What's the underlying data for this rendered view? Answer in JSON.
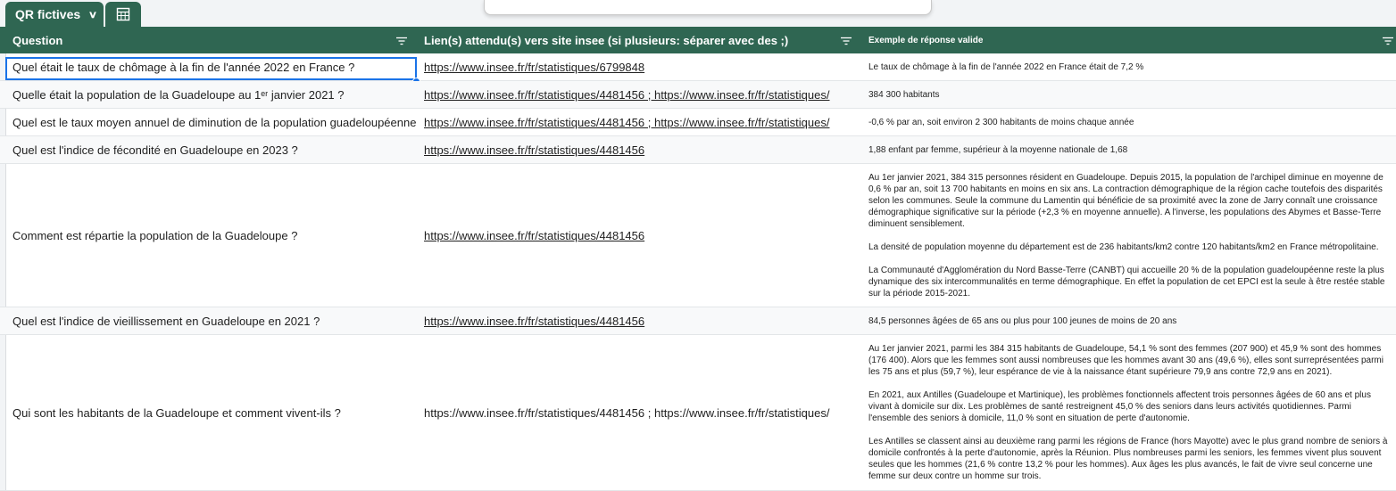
{
  "sheet_tab": {
    "label": "QR fictives"
  },
  "header": {
    "col1": "Question",
    "col2": "Lien(s) attendu(s) vers site insee (si plusieurs: séparer avec des  ;)",
    "col3": "Exemple de réponse valide"
  },
  "rows": [
    {
      "question": "Quel était le taux de chômage à la fin de l'année 2022 en France ?",
      "link": "https://www.insee.fr/fr/statistiques/6799848",
      "answer": "Le taux de chômage à la fin de l'année 2022 en France était de 7,2 %"
    },
    {
      "question": "Quelle était la population de la Guadeloupe au 1ᵉʳ janvier 2021 ?",
      "link": "https://www.insee.fr/fr/statistiques/4481456 ; https://www.insee.fr/fr/statistiques/",
      "answer": "384 300 habitants"
    },
    {
      "question": "Quel est le taux moyen annuel de diminution de la population guadeloupéenne",
      "link": "https://www.insee.fr/fr/statistiques/4481456 ; https://www.insee.fr/fr/statistiques/",
      "answer": "-0,6 % par an, soit environ 2 300 habitants de moins chaque année"
    },
    {
      "question": "Quel est l'indice de fécondité en Guadeloupe en 2023 ?",
      "link": "https://www.insee.fr/fr/statistiques/4481456",
      "answer": "1,88 enfant par femme, supérieur à la moyenne nationale de 1,68"
    },
    {
      "question": "Comment est répartie la population de la Guadeloupe ?",
      "link": "https://www.insee.fr/fr/statistiques/4481456",
      "answer": "Au 1er janvier 2021, 384 315 personnes résident en Guadeloupe. Depuis 2015, la population de l'archipel diminue en moyenne de 0,6 % par an, soit 13 700 habitants en moins en six ans. La contraction démographique de la région cache toutefois des disparités selon les communes. Seule la commune du Lamentin qui bénéficie de sa proximité avec la zone de Jarry connaît une croissance démographique significative sur la période (+2,3 % en moyenne annuelle). A l'inverse, les populations des Abymes et Basse-Terre diminuent sensiblement.\n\nLa densité de population moyenne du département est de 236 habitants/km2 contre 120 habitants/km2 en France métropolitaine.\n\nLa Communauté d'Agglomération du Nord Basse-Terre (CANBT) qui accueille 20 % de la population guadeloupéenne reste la plus dynamique des six intercommunalités en terme démographique. En effet la population de cet EPCI est la seule à être restée stable sur la période 2015-2021."
    },
    {
      "question": "Quel est l'indice de vieillissement en Guadeloupe en 2021 ?",
      "link": "https://www.insee.fr/fr/statistiques/4481456",
      "answer": "84,5 personnes âgées de 65 ans ou plus pour 100 jeunes de moins de 20 ans"
    },
    {
      "question": "Qui sont les habitants de la Guadeloupe et comment vivent-ils ?",
      "link": "https://www.insee.fr/fr/statistiques/4481456 ; https://www.insee.fr/fr/statistiques/",
      "answer": "Au 1er janvier 2021, parmi les 384 315 habitants de Guadeloupe, 54,1 % sont des femmes (207 900) et 45,9 % sont des hommes (176 400). Alors que les femmes sont aussi nombreuses que les hommes avant 30 ans (49,6 %), elles sont surreprésentées parmi les 75 ans et plus (59,7 %), leur espérance de vie à la naissance étant supérieure 79,9 ans contre 72,9 ans en 2021).\n\nEn 2021, aux Antilles (Guadeloupe et Martinique), les problèmes fonctionnels affectent trois personnes âgées de 60 ans et plus vivant à domicile sur dix. Les problèmes de santé restreignent 45,0 % des seniors dans leurs activités quotidiennes. Parmi l'ensemble des seniors à domicile, 11,0 % sont en situation de perte d'autonomie.\n\nLes Antilles se classent ainsi au deuxième rang parmi les régions de France (hors Mayotte) avec le plus grand nombre de seniors à domicile confrontés à la perte d'autonomie, après la Réunion. Plus nombreuses parmi les seniors, les femmes vivent plus souvent seules que les hommes (21,6 % contre 13,2 % pour les hommes). Aux âges les plus avancés, le fait de vivre seul concerne une femme sur deux contre un homme sur trois."
    }
  ]
}
